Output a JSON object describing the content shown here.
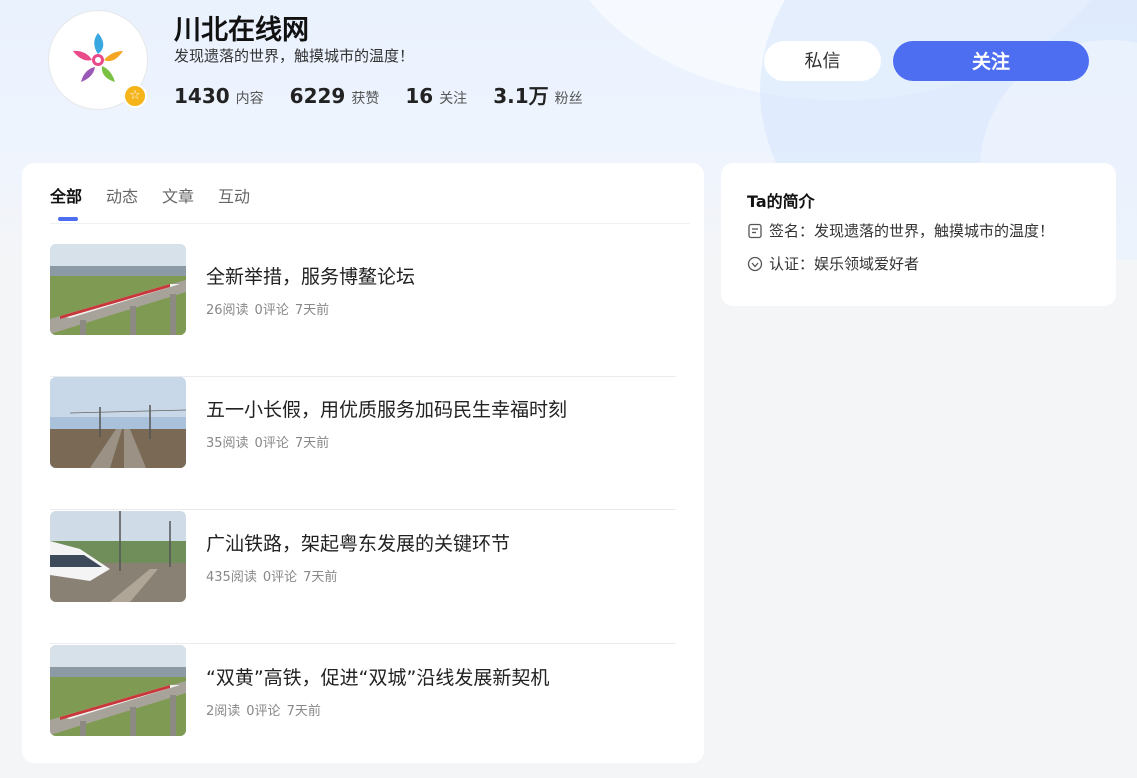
{
  "profile": {
    "name": "川北在线网",
    "motto": "发现遗落的世界，触摸城市的温度！",
    "badge_icon": "star-badge",
    "stats": [
      {
        "value": "1430",
        "label": "内容"
      },
      {
        "value": "6229",
        "label": "获赞"
      },
      {
        "value": "16",
        "label": "关注"
      },
      {
        "value": "3.1万",
        "label": "粉丝"
      }
    ]
  },
  "actions": {
    "message_label": "私信",
    "follow_label": "关注"
  },
  "tabs": [
    "全部",
    "动态",
    "文章",
    "互动"
  ],
  "articles": [
    {
      "title": "全新举措，服务博鳌论坛",
      "reads": "26阅读",
      "comments": "0评论",
      "time": "7天前",
      "thumb": "train-bridge"
    },
    {
      "title": "五一小长假，用优质服务加码民生幸福时刻",
      "reads": "35阅读",
      "comments": "0评论",
      "time": "7天前",
      "thumb": "railway-tracks"
    },
    {
      "title": "广汕铁路，架起粤东发展的关键环节",
      "reads": "435阅读",
      "comments": "0评论",
      "time": "7天前",
      "thumb": "bullet-train"
    },
    {
      "title": "“双黄”高铁，促进“双城”沿线发展新契机",
      "reads": "2阅读",
      "comments": "0评论",
      "time": "7天前",
      "thumb": "train-bridge"
    }
  ],
  "intro": {
    "title": "Ta的简介",
    "signature": "签名：发现遗落的世界，触摸城市的温度！",
    "certification": "认证：娱乐领域爱好者"
  },
  "colors": {
    "accent": "#4e6ef2",
    "badge": "#f4b41a"
  }
}
